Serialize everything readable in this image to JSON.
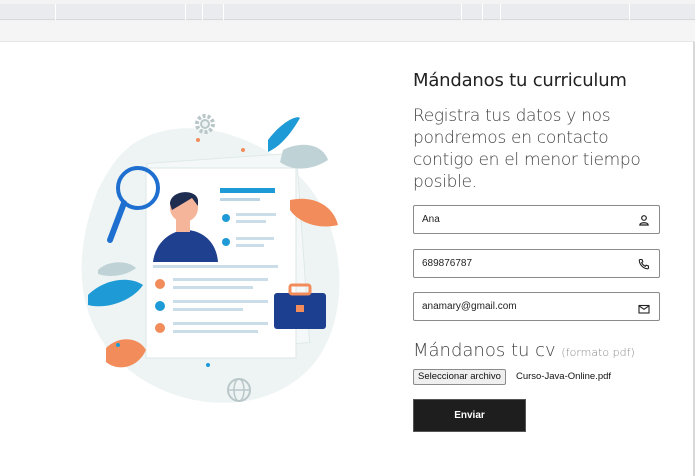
{
  "form": {
    "title": "Mándanos tu curriculum",
    "subtitle": "Registra tus datos y nos pondremos en contacto contigo en el menor tiempo posible.",
    "name_value": "Ana",
    "phone_value": "689876787",
    "email_value": "anamary@gmail.com",
    "cv_title": "Mándanos tu cv",
    "cv_hint": "(formato pdf)",
    "file_button": "Seleccionar archivo",
    "file_name": "Curso-Java-Online.pdf",
    "submit_label": "Enviar"
  },
  "icons": {
    "name": "user-icon",
    "phone": "phone-icon",
    "email": "envelope-icon"
  },
  "colors": {
    "submit_bg": "#1e1e1e",
    "accent_blue": "#1e9ad6",
    "accent_orange": "#f28c5a"
  }
}
